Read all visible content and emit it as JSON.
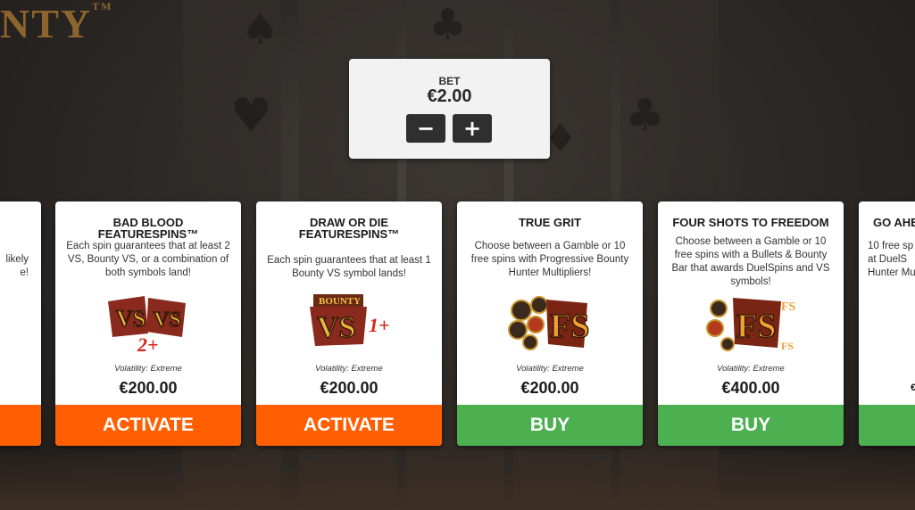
{
  "background": {
    "game_logo_text": "NTY",
    "game_logo_tm": "TM"
  },
  "bet": {
    "label": "BET",
    "value": "€2.00",
    "decrease_label": "−",
    "increase_label": "+"
  },
  "cards": [
    {
      "title": "",
      "description": "likely\ne!",
      "volatility": "",
      "price": "",
      "action_label": "",
      "action_color": "#ff5f00"
    },
    {
      "title": "BAD BLOOD FEATURESPINS™",
      "description": "Each spin guarantees that at least 2 VS, Bounty VS, or a combination of both symbols land!",
      "art_icon": "vs-symbols-2plus-icon",
      "volatility": "Volatility: Extreme",
      "price": "€200.00",
      "action_label": "ACTIVATE",
      "action_color": "#ff5f00"
    },
    {
      "title": "DRAW OR DIE FEATURESPINS™",
      "description": "Each spin guarantees that at least 1 Bounty VS symbol lands!",
      "art_icon": "bounty-vs-1plus-icon",
      "volatility": "Volatility: Extreme",
      "price": "€200.00",
      "action_label": "ACTIVATE",
      "action_color": "#ff5f00"
    },
    {
      "title": "TRUE GRIT",
      "description": "Choose between a Gamble or 10 free spins with Progressive Bounty Hunter Multipliers!",
      "art_icon": "fs-bounty-coins-icon",
      "volatility": "Volatility: Extreme",
      "price": "€200.00",
      "action_label": "BUY",
      "action_color": "#4caf50"
    },
    {
      "title": "FOUR SHOTS TO FREEDOM",
      "description": "Choose between a Gamble or 10 free spins with a Bullets & Bounty Bar that awards DuelSpins and VS symbols!",
      "art_icon": "fs-bullets-bounty-icon",
      "volatility": "Volatility: Extreme",
      "price": "€400.00",
      "action_label": "BUY",
      "action_color": "#4caf50"
    },
    {
      "title": "GO AHE",
      "description": "10 free sp\nat DuelS\nHunter Mu",
      "volatility": "",
      "price": "€",
      "action_label": "",
      "action_color": "#4caf50"
    }
  ]
}
